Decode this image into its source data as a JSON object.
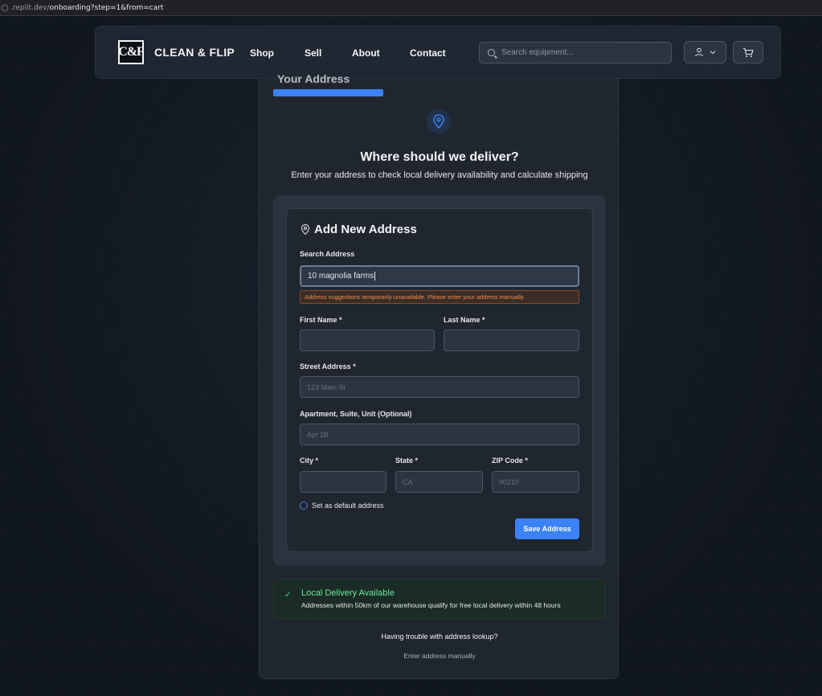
{
  "browser": {
    "url_prefix": ".replit.dev/",
    "url_path": "onboarding?step=1&from=cart"
  },
  "header": {
    "logo_mark": "C&F",
    "brand": "CLEAN & FLIP",
    "nav": [
      "Shop",
      "Sell",
      "About",
      "Contact"
    ],
    "search_placeholder": "Search equipment..."
  },
  "step": {
    "peek_title": "Your Address",
    "progress_percent": 33
  },
  "intro": {
    "heading": "Where should we deliver?",
    "subtitle": "Enter your address to check local delivery availability and calculate shipping"
  },
  "form": {
    "title": "Add New Address",
    "search_label": "Search Address",
    "search_value": "10 magnolia farms",
    "warning": "Address suggestions temporarily unavailable. Please enter your address manually.",
    "first_name_label": "First Name *",
    "last_name_label": "Last Name *",
    "street_label": "Street Address *",
    "street_placeholder": "123 Main St",
    "apt_label": "Apartment, Suite, Unit (Optional)",
    "apt_placeholder": "Apt 2B",
    "city_label": "City *",
    "state_label": "State *",
    "state_placeholder": "CA",
    "zip_label": "ZIP Code *",
    "zip_placeholder": "90210",
    "default_label": "Set as default address",
    "save_label": "Save Address"
  },
  "delivery": {
    "title": "Local Delivery Available",
    "text": "Addresses within 50km of our warehouse qualify for free local delivery within 48 hours"
  },
  "help": {
    "question": "Having trouble with address lookup?",
    "manual_link": "Enter address manually"
  },
  "colors": {
    "accent": "#3b82f6",
    "success": "#6ee7a0",
    "warning": "#f28c4c"
  }
}
